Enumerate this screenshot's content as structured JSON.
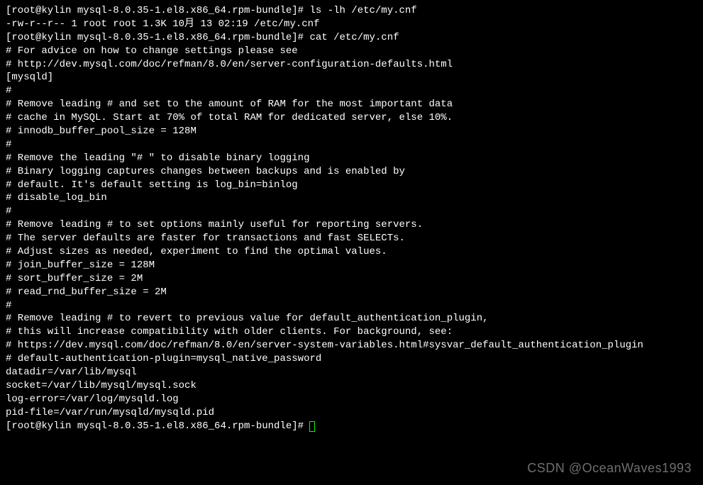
{
  "prompt": "[root@kylin mysql-8.0.35-1.el8.x86_64.rpm-bundle]# ",
  "cmd1": "ls -lh /etc/my.cnf",
  "ls_out": "-rw-r--r-- 1 root root 1.3K 10月 13 02:19 /etc/my.cnf",
  "cmd2": "cat /etc/my.cnf",
  "file": {
    "l1": "# For advice on how to change settings please see",
    "l2": "# http://dev.mysql.com/doc/refman/8.0/en/server-configuration-defaults.html",
    "l3": "",
    "l4": "[mysqld]",
    "l5": "#",
    "l6": "# Remove leading # and set to the amount of RAM for the most important data",
    "l7": "# cache in MySQL. Start at 70% of total RAM for dedicated server, else 10%.",
    "l8": "# innodb_buffer_pool_size = 128M",
    "l9": "#",
    "l10": "# Remove the leading \"# \" to disable binary logging",
    "l11": "# Binary logging captures changes between backups and is enabled by",
    "l12": "# default. It's default setting is log_bin=binlog",
    "l13": "# disable_log_bin",
    "l14": "#",
    "l15": "# Remove leading # to set options mainly useful for reporting servers.",
    "l16": "# The server defaults are faster for transactions and fast SELECTs.",
    "l17": "# Adjust sizes as needed, experiment to find the optimal values.",
    "l18": "# join_buffer_size = 128M",
    "l19": "# sort_buffer_size = 2M",
    "l20": "# read_rnd_buffer_size = 2M",
    "l21": "#",
    "l22": "# Remove leading # to revert to previous value for default_authentication_plugin,",
    "l23": "# this will increase compatibility with older clients. For background, see:",
    "l24": "# https://dev.mysql.com/doc/refman/8.0/en/server-system-variables.html#sysvar_default_authentication_plugin",
    "l25": "# default-authentication-plugin=mysql_native_password",
    "l26": "",
    "l27": "datadir=/var/lib/mysql",
    "l28": "socket=/var/lib/mysql/mysql.sock",
    "l29": "",
    "l30": "log-error=/var/log/mysqld.log",
    "l31": "pid-file=/var/run/mysqld/mysqld.pid"
  },
  "watermark": "CSDN @OceanWaves1993"
}
